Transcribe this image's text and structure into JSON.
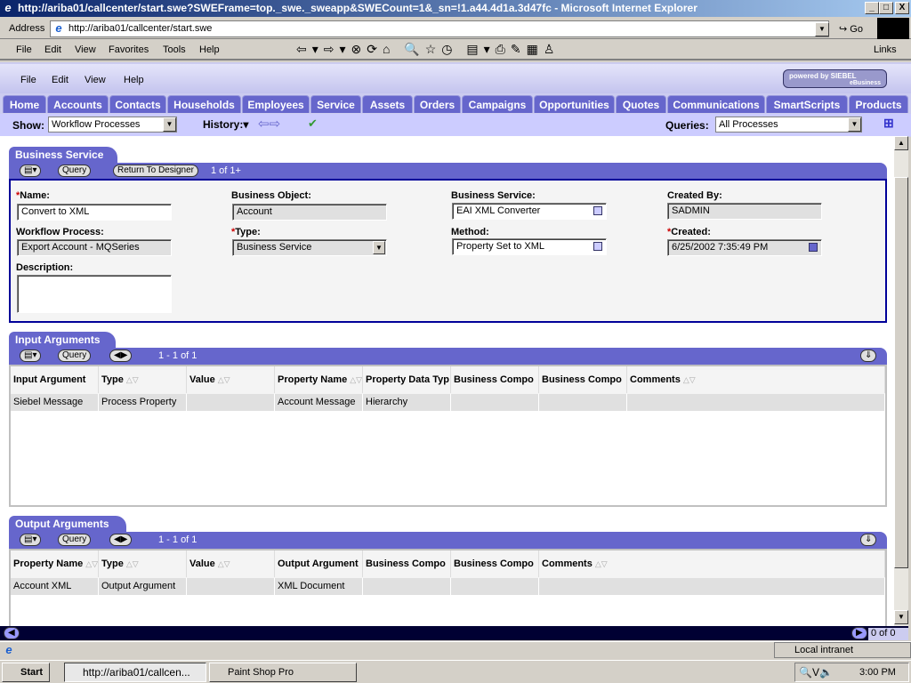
{
  "window": {
    "title": "http://ariba01/callcenter/start.swe?SWEFrame=top._swe._sweapp&SWECount=1&_sn=!1.a44.4d1a.3d47fc - Microsoft Internet Explorer",
    "min": "_",
    "max": "□",
    "close": "X"
  },
  "address": {
    "label": "Address",
    "url": "http://ariba01/callcenter/start.swe",
    "go": "Go",
    "links": "Links"
  },
  "ie_menu": [
    "File",
    "Edit",
    "View",
    "Favorites",
    "Tools",
    "Help"
  ],
  "siebel_menu": [
    "File",
    "Edit",
    "View",
    "Help"
  ],
  "logo": {
    "line1": "powered by SIEBEL",
    "line2": "eBusiness"
  },
  "tabs": [
    "Home",
    "Accounts",
    "Contacts",
    "Households",
    "Employees",
    "Service",
    "Assets",
    "Orders",
    "Campaigns",
    "Opportunities",
    "Quotes",
    "Communications",
    "SmartScripts",
    "Products"
  ],
  "toolbar": {
    "show_label": "Show:",
    "show_value": "Workflow Processes",
    "history": "History:",
    "queries_label": "Queries:",
    "queries_value": "All Processes"
  },
  "business_service": {
    "title": "Business Service",
    "query": "Query",
    "return": "Return To Designer",
    "count": "1 of 1+",
    "name_label": "Name:",
    "name": "Convert to XML",
    "bo_label": "Business Object:",
    "bo": "Account",
    "bs_label": "Business Service:",
    "bs": "EAI XML Converter",
    "created_by_label": "Created By:",
    "created_by": "SADMIN",
    "wp_label": "Workflow Process:",
    "wp": "Export Account - MQSeries",
    "type_label": "Type:",
    "type": "Business Service",
    "method_label": "Method:",
    "method": "Property Set to XML",
    "created_label": "Created:",
    "created": "6/25/2002 7:35:49 PM",
    "desc_label": "Description:"
  },
  "input_args": {
    "title": "Input Arguments",
    "query": "Query",
    "count": "1 - 1 of 1",
    "columns": [
      "Input Argument",
      "Type",
      "Value",
      "Property Name",
      "Property Data Typ",
      "Business Compo",
      "Business Compo",
      "Comments"
    ],
    "rows": [
      [
        "Siebel Message",
        "Process Property",
        "",
        "Account Message",
        "Hierarchy",
        "",
        "",
        ""
      ]
    ]
  },
  "output_args": {
    "title": "Output Arguments",
    "query": "Query",
    "count": "1 - 1 of 1",
    "columns": [
      "Property Name",
      "Type",
      "Value",
      "Output Argument",
      "Business Compo",
      "Business Compo",
      "Comments"
    ],
    "rows": [
      [
        "Account XML",
        "Output Argument",
        "",
        "XML Document",
        "",
        "",
        ""
      ]
    ]
  },
  "hbar_count": "0 of 0",
  "status": {
    "zone": "Local intranet"
  },
  "taskbar": {
    "start": "Start",
    "items": [
      "http://ariba01/callcen...",
      "Paint Shop Pro"
    ],
    "clock": "3:00 PM"
  }
}
